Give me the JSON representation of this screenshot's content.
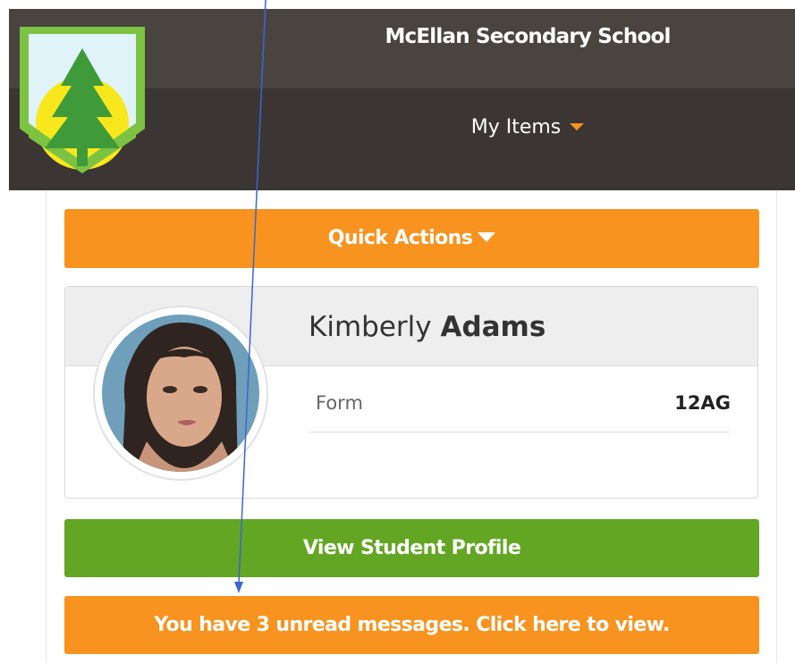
{
  "header": {
    "school_name": "McEllan Secondary School",
    "menu_label": "My Items",
    "logo_icon": "pine-tree-logo"
  },
  "actions": {
    "quick_actions_label": "Quick Actions",
    "view_profile_label": "View Student Profile",
    "messages_label": "You have 3 unread messages. Click here to view."
  },
  "student": {
    "first_name": "Kimberly",
    "last_name": "Adams",
    "fields": [
      {
        "label": "Form",
        "value": "12AG"
      }
    ]
  },
  "colors": {
    "header_dark": "#3b3533",
    "header_top": "#4a4441",
    "accent_orange": "#f7931e",
    "success_green": "#63a624",
    "annotation_blue": "#3b66d1"
  }
}
